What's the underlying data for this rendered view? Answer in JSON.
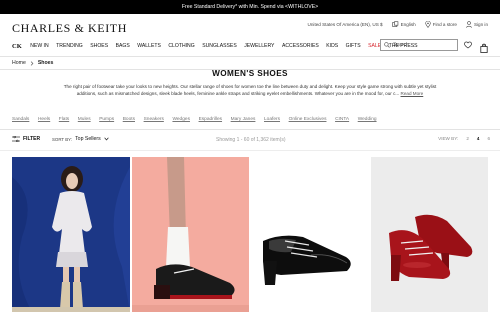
{
  "promo": "Free Standard Delivery* with Min. Spend via <WITHLOVE>",
  "utility": {
    "region": "United States Of America (EN), US $",
    "language": "English",
    "store": "Find a store",
    "signin": "Sign in"
  },
  "brand": {
    "logo": "CHARLES & KEITH",
    "mark": "CK"
  },
  "nav": [
    "NEW IN",
    "TRENDING",
    "SHOES",
    "BAGS",
    "WALLETS",
    "CLOTHING",
    "SUNGLASSES",
    "JEWELLERY",
    "ACCESSORIES",
    "KIDS",
    "GIFTS",
    "SALE",
    "THE PRESS"
  ],
  "search": {
    "placeholder": "Search"
  },
  "bag_count": "0",
  "breadcrumb": {
    "home": "Home",
    "current": "Shoes"
  },
  "page": {
    "title": "WOMEN'S SHOES",
    "description": "The right pair of footwear take your looks to new heights. Our stellar range of shoes for women toe the line between duty and delight. Keep your style game strong with subtle yet stylist additions, such as mismatched designs, sleek blade heels, feminine ankle straps and striking eyelet embellishments. Whatever you are in the mood for, our c...",
    "read_more": "Read More"
  },
  "categories": [
    "Sandals",
    "Heels",
    "Flats",
    "Mules",
    "Pumps",
    "Boots",
    "Sneakers",
    "Wedges",
    "Espadrilles",
    "Mary Janes",
    "Loafers",
    "Online Exclusives",
    "CINTA",
    "Wedding"
  ],
  "toolbar": {
    "filter": "FILTER",
    "sort_label": "SORT BY:",
    "sort_value": "Top Sellers",
    "showing": "Showing 1 - 60 of 1,362 item(s)",
    "view_label": "VIEW BY:",
    "view_options": [
      "2",
      "4",
      "6"
    ],
    "view_selected": "4"
  },
  "colors": {
    "promo_bg": "#000000",
    "sale": "#d6232b",
    "tile1_bg": "#1e3c8f",
    "tile2_bg": "#f4ab9f",
    "tile4_bg": "#ececec",
    "red_shoe": "#a8141b"
  },
  "icons": [
    "location-pin-icon",
    "globe-icon",
    "store-icon",
    "user-icon",
    "search-icon",
    "heart-icon",
    "bag-icon",
    "filter-icon",
    "chevron-down-icon",
    "chevron-right-icon"
  ]
}
